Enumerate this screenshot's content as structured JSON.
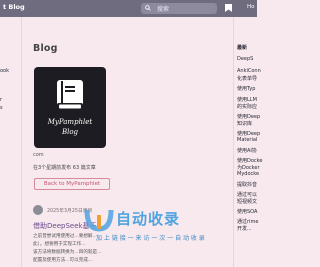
{
  "header": {
    "brand": "t Blog",
    "search_placeholder": "搜索",
    "right_link": "Ho"
  },
  "left_sidebar": {
    "items": [
      "ook",
      "r",
      "s"
    ]
  },
  "blog": {
    "page_title": "Blog",
    "cover_title_line1": "MyPamphlet",
    "cover_title_line2": "Blog",
    "domain": "com",
    "stats": "在3个星期前发布  63 篇文章",
    "back_button": "Back to MyPamphlet"
  },
  "post": {
    "meta": "2025年3月25日更新",
    "title": "借助DeepSeek基于",
    "body_line1": "之前曾尝试用使用过...要想解...",
    "body_line2": "此）。想要用于实现工作...",
    "body_line3": "该方法将数据转换为...目的就是...",
    "body_line4": "配置及使用方法...可以完成..."
  },
  "right_sidebar": {
    "items": [
      "最新",
      "DeepS",
      "AnkiConn",
      "化表单导",
      "使用Typ",
      "使用LLM",
      "的实际应",
      "使用Deep",
      "知识库",
      "使用Deep",
      "Material",
      "使用AI协",
      "使用Docke",
      "为Docker",
      "Mydocke",
      "提取抖音",
      "通过可以",
      "短视频文",
      "使用SOA",
      "通过rime",
      "开发..."
    ]
  },
  "watermark": {
    "name": "自动收录",
    "slogan": "加 上 链 接 一 来 访 一 次 一 自 动 收 录"
  },
  "colors": {
    "topbar": "#6f6c80",
    "background": "#f7e9ee",
    "accent": "#c2576d",
    "watermark": "#4fa3e0"
  }
}
